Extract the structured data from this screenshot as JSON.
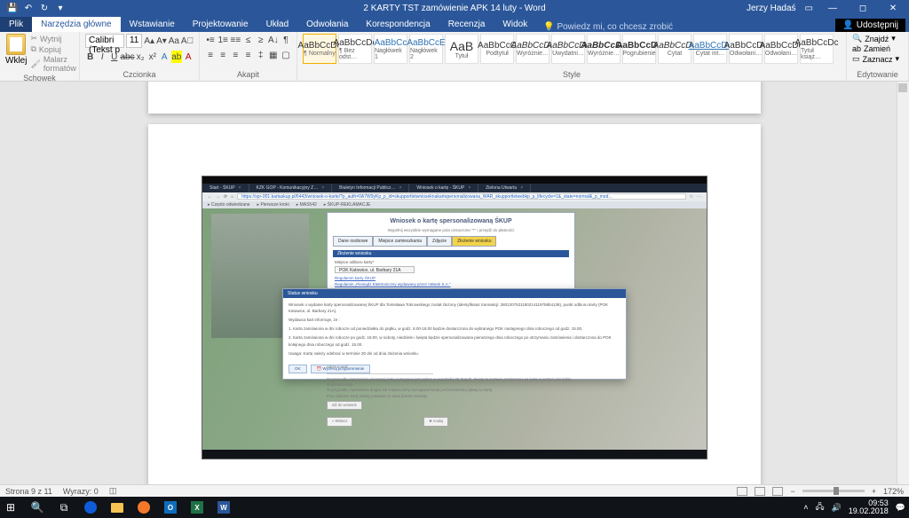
{
  "titlebar": {
    "title": "2 KARTY TST zamówienie APK 14 luty  -  Word",
    "user": "Jerzy Hadaś"
  },
  "tabs": {
    "file": "Plik",
    "home": "Narzędzia główne",
    "insert": "Wstawianie",
    "design": "Projektowanie",
    "layout": "Układ",
    "references": "Odwołania",
    "mailings": "Korespondencja",
    "review": "Recenzja",
    "view": "Widok",
    "tell_me": "Powiedz mi, co chcesz zrobić",
    "share": "Udostępnij"
  },
  "ribbon": {
    "clipboard": {
      "label": "Schowek",
      "paste": "Wklej",
      "cut": "Wytnij",
      "copy": "Kopiuj",
      "painter": "Malarz formatów"
    },
    "font": {
      "label": "Czcionka",
      "name": "Calibri (Tekst p",
      "size": "11"
    },
    "paragraph": {
      "label": "Akapit"
    },
    "styles": {
      "label": "Style",
      "items": [
        {
          "preview": "AaBbCcDc",
          "name": "¶ Normalny",
          "cls": ""
        },
        {
          "preview": "AaBbCcDc",
          "name": "¶ Bez odst…",
          "cls": ""
        },
        {
          "preview": "AaBbCc",
          "name": "Nagłówek 1",
          "cls": "blue"
        },
        {
          "preview": "AaBbCcE",
          "name": "Nagłówek 2",
          "cls": "blue"
        },
        {
          "preview": "AaB",
          "name": "Tytuł",
          "cls": "big"
        },
        {
          "preview": "AaBbCcC",
          "name": "Podtytuł",
          "cls": ""
        },
        {
          "preview": "AaBbCcDc",
          "name": "Wyróżnie…",
          "cls": "ital"
        },
        {
          "preview": "AaBbCcDc",
          "name": "Uwydatni…",
          "cls": "ital"
        },
        {
          "preview": "AaBbCcDc",
          "name": "Wyróżnie…",
          "cls": "bold ital"
        },
        {
          "preview": "AaBbCcDc",
          "name": "Pogrubienie",
          "cls": "bold"
        },
        {
          "preview": "AaBbCcDc",
          "name": "Cytat",
          "cls": "ital"
        },
        {
          "preview": "AaBbCcDc",
          "name": "Cytat int…",
          "cls": "blue ul"
        },
        {
          "preview": "AaBbCcDc",
          "name": "Odwołani…",
          "cls": ""
        },
        {
          "preview": "AaBbCcDc",
          "name": "Odwołani…",
          "cls": ""
        },
        {
          "preview": "AaBbCcDc",
          "name": "Tytuł książ…",
          "cls": ""
        }
      ]
    },
    "editing": {
      "label": "Edytowanie",
      "find": "Znajdź",
      "replace": "Zamień",
      "select": "Zaznacz"
    }
  },
  "document": {
    "browser": {
      "tabs": [
        "Start - ŚKUP",
        "KZK GOP - Komunikacyjny Z…",
        "Biuletyn Informacji Publicz…",
        "Wniosek o kartę - ŚKUP",
        "Zielona Utwartu"
      ],
      "url": "https://spr-001.kartaskup.pl/6443/wniosek-o-karte/?p_auth=0A7W9yKp_p_id=skupportletwnioseknakartepersonalizowana_WAR_skupportletwebkp_p_lifecycle=1&_state=normal&_p_mod…",
      "bookmarks": [
        "Często odwiedzane",
        "Pierwsze kroki",
        "MAS542",
        "ŚKUP-REKLAMACJE"
      ],
      "form": {
        "title": "Wniosek o kartę spersonalizowaną ŚKUP",
        "subtitle": "Wypełnij wszystkie wymagane pola oznaczone \"*\" i przejdź do płatności",
        "steps": [
          "Dane osobowe",
          "Miejsce zamieszkania",
          "Zdjęcie",
          "Złożenie wniosku"
        ],
        "section": "Złożenie wniosku",
        "pick_label": "Miejsce odbioru karty*",
        "pick_value": "POK Katowice, ul. Barbary 21A",
        "link1": "Regulamin karty ŚKUP",
        "link2": "Regulamin „Pieniądz Elektroniczny wydawany przez mBank S.A.”"
      },
      "modal": {
        "header": "Status wniosku",
        "line1": "Wniosek o wydanie karty spersonalizowanej ŚKUP dla Tomisława Tokrowskiego został złożony (identyfikator transakcji: 2801207521180214119758b4138), punkt odbioru karty (POK Katowice, ul. Barbary 21A).",
        "line2": "Wydawca kart informuje, że :",
        "line3": "1. Karta zamówiona w dni robocze od poniedziałku do piątku, w godz. 8.00-18.00 będzie dostarczona do wybranego POK następnego dnia roboczego od godz. 15.00,",
        "line4": "2. Karta zamówiona w dni robocze po godz. 18.00, w soboty, niedziele i święta będzie spersonalizowana pierwszego dnia roboczego po otrzymaniu zamówienia i dostarczona do POK kolejnego dnia roboczego od godz. 15.00.",
        "line5": "Uwaga: Kartę należy odebrać w terminie 30 dni od dnia złożenia wniosku.",
        "btn_ok": "OK",
        "btn_remind": "Wyzeruj przypomnienie"
      },
      "lower": {
        "l1": "Adres e-mail",
        "l2": "W przypadku zamówienia pierwszej karty wymagana jest wpłata w wysokości 20 złotych. Kwota ta zostanie przekazana na kartę w postaci pieniądza elektronicznego.",
        "l3": "W przypadku zamówienia drugiej lub kolejnej karty wymagana kwota jest bezzwrotną opłatą za kartę.",
        "l4": "Przy odbiorze karty należy posiadać ze sobą dowód osobisty.",
        "btn_pay": "Idź do wniosek",
        "btn_back": "« Wstecz",
        "btn_cancel": "✖ Anuluj"
      }
    }
  },
  "statusbar": {
    "page": "Strona 9 z 11",
    "words": "Wyrazy: 0",
    "lang_ic": "polski",
    "zoom": "172%"
  },
  "taskbar": {
    "time": "09:53",
    "date": "19.02.2018"
  }
}
